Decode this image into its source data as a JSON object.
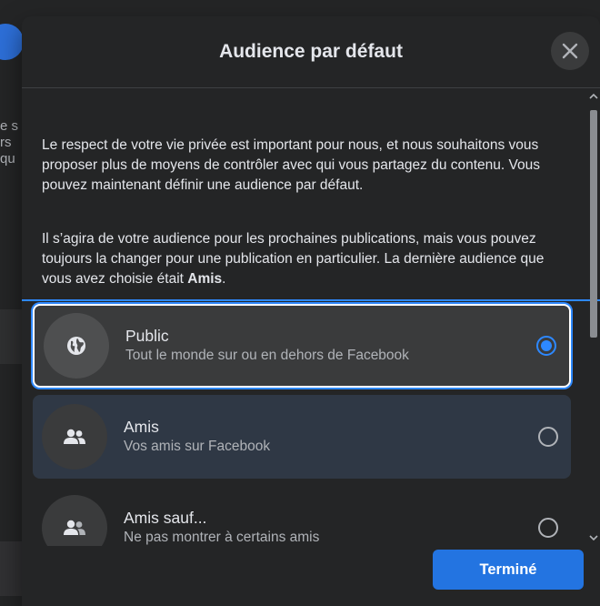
{
  "modal": {
    "title": "Audience par défaut",
    "description_1": "Le respect de votre vie privée est important pour nous, et nous souhaitons vous proposer plus de moyens de contrôler avec qui vous partagez du contenu. Vous pouvez maintenant définir une audience par défaut.",
    "description_2_prefix": "Il s’agira de votre audience pour les prochaines publications, mais vous pouvez toujours la changer pour une publication en particulier. La dernière audience que vous avez choisie était ",
    "description_2_bold": "Amis",
    "description_2_suffix": ".",
    "options": [
      {
        "title": "Public",
        "subtitle": "Tout le monde sur ou en dehors de Facebook",
        "icon": "globe-icon",
        "selected": true
      },
      {
        "title": "Amis",
        "subtitle": "Vos amis sur Facebook",
        "icon": "friends-icon",
        "selected": false
      },
      {
        "title": "Amis sauf...",
        "subtitle": "Ne pas montrer à certains amis",
        "icon": "friends-except-icon",
        "selected": false
      }
    ],
    "done_label": "Terminé"
  },
  "colors": {
    "accent": "#2d88ff",
    "button": "#2374e1",
    "modal_bg": "#242526",
    "text_primary": "#e4e6eb",
    "text_secondary": "#b0b3b8"
  }
}
